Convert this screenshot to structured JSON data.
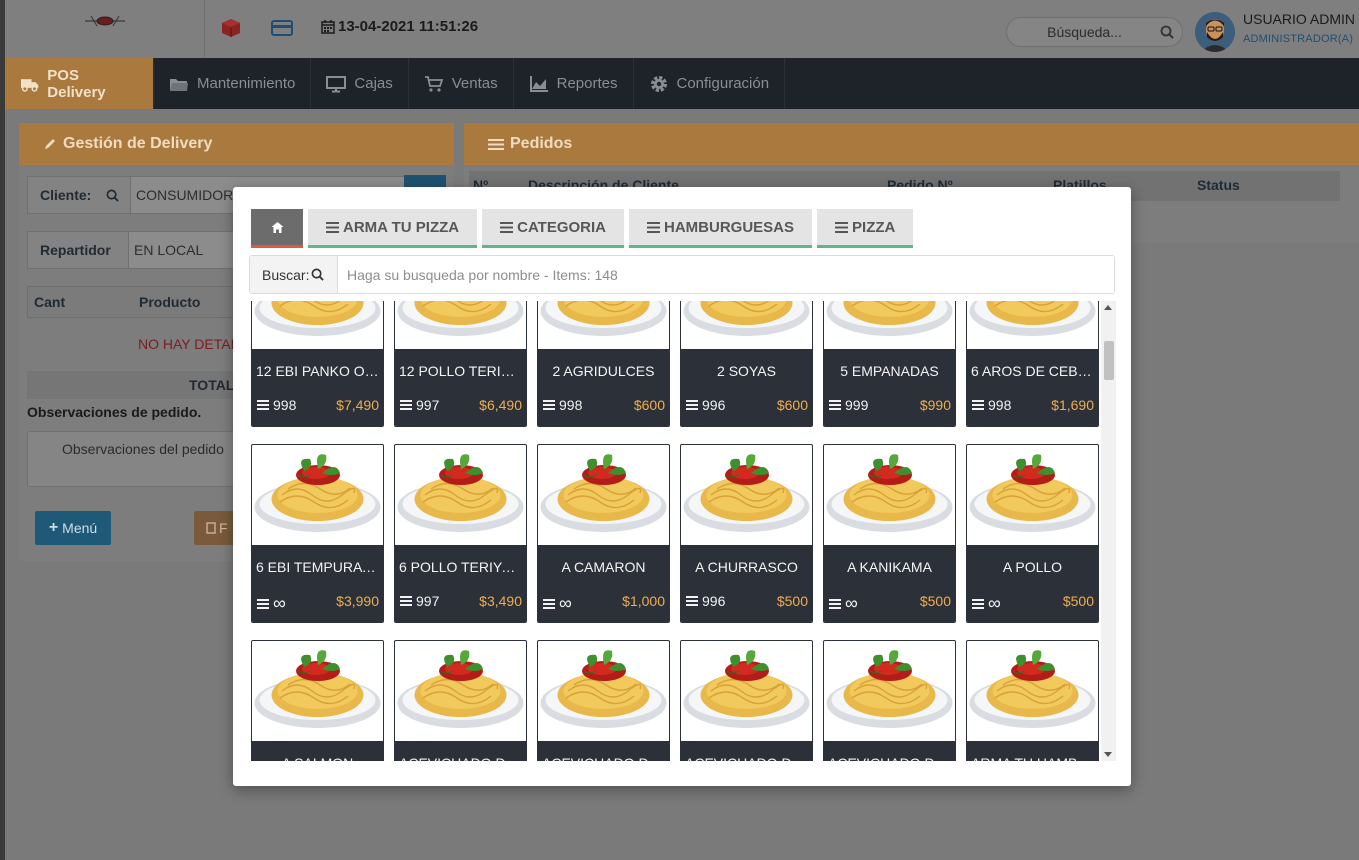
{
  "header": {
    "datetime": "13-04-2021 11:51:26",
    "search_placeholder": "Búsqueda...",
    "user_name": "USUARIO ADMIN",
    "user_role": "ADMINISTRADOR(A)",
    "icons": [
      "logo-icon",
      "cube-icon",
      "credit-card-icon",
      "calendar-icon",
      "search-icon",
      "avatar"
    ]
  },
  "nav": {
    "items": [
      {
        "label": "POS Delivery",
        "icon": "truck-icon",
        "active": true
      },
      {
        "label": "Mantenimiento",
        "icon": "folder-icon"
      },
      {
        "label": "Cajas",
        "icon": "monitor-icon"
      },
      {
        "label": "Ventas",
        "icon": "cart-icon"
      },
      {
        "label": "Reportes",
        "icon": "area-chart-icon"
      },
      {
        "label": "Configuración",
        "icon": "gear-icon"
      }
    ]
  },
  "delivery_panel": {
    "title": "Gestión de Delivery",
    "cliente_label": "Cliente:",
    "cliente_value": "CONSUMIDOR F",
    "repartidor_label": "Repartidor",
    "repartidor_value": "EN LOCAL",
    "col_cant": "Cant",
    "col_producto": "Producto",
    "no_detalle": "NO HAY DETALL",
    "total_label": "TOTAL",
    "observaciones_label": "Observaciones de pedido.",
    "observaciones_placeholder": "Observaciones del pedido",
    "menu_button": "Menú",
    "f_button": "F"
  },
  "pedidos_panel": {
    "title": "Pedidos",
    "columns": [
      "Nº",
      "Descripción de Cliente",
      "Pedido Nº",
      "Platillos",
      "Status"
    ]
  },
  "modal": {
    "tabs": [
      "ARMA TU PIZZA",
      "CATEGORIA",
      "HAMBURGUESAS",
      "PIZZA"
    ],
    "search_label": "Buscar:",
    "search_placeholder": "Haga su busqueda por nombre - Items: 148",
    "products": [
      {
        "name": "12 EBI PANKO O T...",
        "stock": "998",
        "price": "$7,490"
      },
      {
        "name": "12 POLLO TERIYA...",
        "stock": "997",
        "price": "$6,490"
      },
      {
        "name": "2 AGRIDULCES",
        "stock": "998",
        "price": "$600"
      },
      {
        "name": "2 SOYAS",
        "stock": "996",
        "price": "$600"
      },
      {
        "name": "5 EMPANADAS",
        "stock": "999",
        "price": "$990"
      },
      {
        "name": "6 AROS DE CEBO...",
        "stock": "998",
        "price": "$1,690"
      },
      {
        "name": "6 EBI TEMPURA O...",
        "stock": "∞",
        "price": "$3,990"
      },
      {
        "name": "6 POLLO TERIYAK...",
        "stock": "997",
        "price": "$3,490"
      },
      {
        "name": "A CAMARON",
        "stock": "∞",
        "price": "$1,000"
      },
      {
        "name": "A CHURRASCO",
        "stock": "996",
        "price": "$500"
      },
      {
        "name": "A KANIKAMA",
        "stock": "∞",
        "price": "$500"
      },
      {
        "name": "A POLLO",
        "stock": "∞",
        "price": "$500"
      },
      {
        "name": "A SALMON",
        "stock": "",
        "price": ""
      },
      {
        "name": "ACEVICHADO DE ...",
        "stock": "",
        "price": ""
      },
      {
        "name": "ACEVICHADO DE ...",
        "stock": "",
        "price": ""
      },
      {
        "name": "ACEVICHADO DE ...",
        "stock": "",
        "price": ""
      },
      {
        "name": "ACEVICHADO DE ...",
        "stock": "",
        "price": ""
      },
      {
        "name": "ARMA TU HAMBU...",
        "stock": "",
        "price": ""
      }
    ]
  },
  "colors": {
    "accent": "#f0ad4e",
    "nav_bg": "#1e232a",
    "card_bg": "#2b3039",
    "tab_underline": "#5cb88a",
    "home_tab_underline": "#e25b36"
  }
}
